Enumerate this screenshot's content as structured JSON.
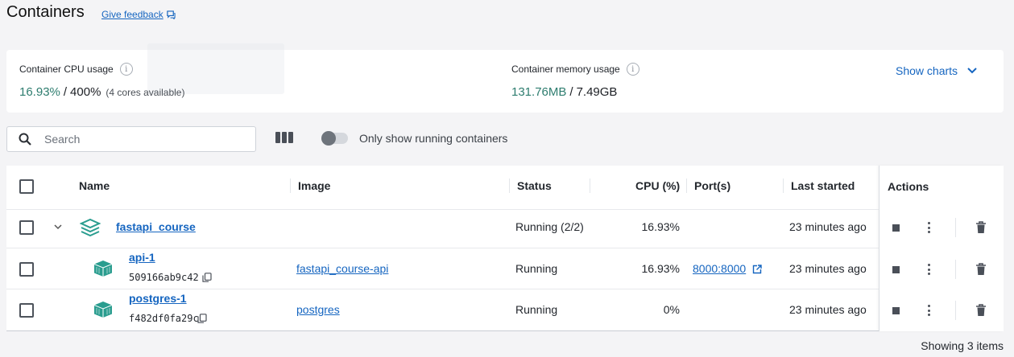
{
  "header": {
    "title": "Containers",
    "feedback_label": "Give feedback"
  },
  "usage": {
    "cpu_label": "Container CPU usage",
    "cpu_used": "16.93%",
    "cpu_sep": "/",
    "cpu_total": "400%",
    "cpu_cores": "(4 cores available)",
    "mem_label": "Container memory usage",
    "mem_used": "131.76MB",
    "mem_sep": "/",
    "mem_total": "7.49GB",
    "info_icon": "i",
    "show_charts_label": "Show charts"
  },
  "toolbar": {
    "search_placeholder": "Search",
    "search_value": "",
    "toggle_label": "Only show running containers",
    "toggle_on": false
  },
  "table": {
    "headers": {
      "name": "Name",
      "image": "Image",
      "status": "Status",
      "cpu": "CPU (%)",
      "ports": "Port(s)",
      "last_started": "Last started",
      "actions": "Actions"
    },
    "group": {
      "name": "fastapi_course",
      "status": "Running (2/2)",
      "cpu": "16.93%",
      "last_started": "23 minutes ago"
    },
    "rows": [
      {
        "name": "api-1",
        "id": "509166ab9c42",
        "image": "fastapi_course-api",
        "status": "Running",
        "cpu": "16.93%",
        "port": "8000:8000",
        "last_started": "23 minutes ago"
      },
      {
        "name": "postgres-1",
        "id": "f482df0fa29c",
        "image": "postgres",
        "status": "Running",
        "cpu": "0%",
        "port": "",
        "last_started": "23 minutes ago"
      }
    ]
  },
  "footer": {
    "count_label": "Showing 3 items"
  },
  "colors": {
    "accent": "#1565c0",
    "usage_green": "#2e7d6f",
    "container_icon": "#2a9d8f"
  }
}
